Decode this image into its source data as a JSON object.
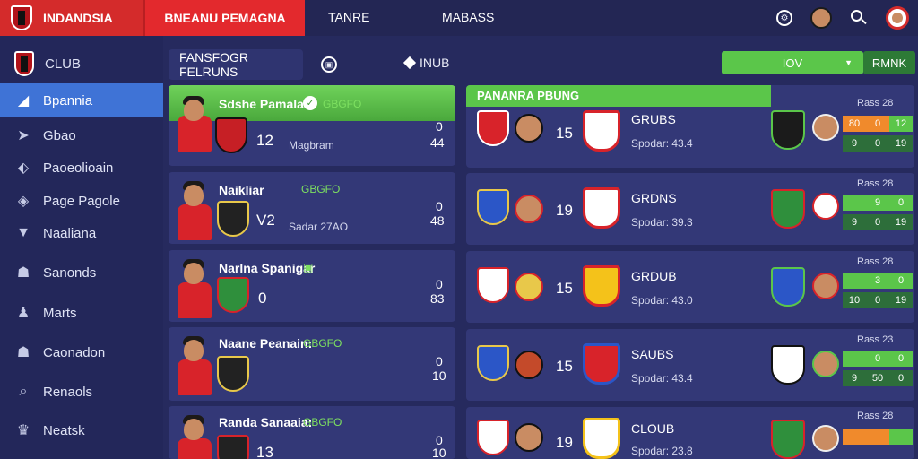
{
  "header": {
    "brand": "INDANDSIA",
    "active_tab": "BNEANU PEMAGNA",
    "tab2": "TANRE",
    "tab3": "MABASS"
  },
  "sidebar": {
    "club_label": "CLUB",
    "items": [
      {
        "label": "Bpannia"
      },
      {
        "label": "Gbao"
      },
      {
        "label": "Paoeolioain"
      },
      {
        "label": "Page Pagole"
      },
      {
        "label": "Naaliana"
      },
      {
        "label": "Sanonds"
      },
      {
        "label": "Marts"
      },
      {
        "label": "Caonadon"
      },
      {
        "label": "Renaols"
      },
      {
        "label": "Neatsk"
      }
    ]
  },
  "toolbar": {
    "filter_label": "FANSFOGR FELRUNS",
    "nav_label": "INUB",
    "select_value": "IOV",
    "action_label": "RMNK"
  },
  "players": [
    {
      "name": "Sdshe Pamalar",
      "tag": "GBGFO",
      "num": "12",
      "sub": "Magbram",
      "a": "0",
      "b": "44"
    },
    {
      "name": "Naikliar",
      "tag": "GBGFO",
      "num": "V2",
      "sub": "Sadar 27AO",
      "a": "0",
      "b": "48"
    },
    {
      "name": "Narlna Spanigar",
      "tag": "",
      "num": "0",
      "sub": "",
      "a": "0",
      "b": "83"
    },
    {
      "name": "Naane Peanain:",
      "tag": "GBGFO",
      "num": "",
      "sub": "",
      "a": "0",
      "b": "10"
    },
    {
      "name": "Randa Sanaaia:",
      "tag": "GBGFO",
      "num": "13",
      "sub": "",
      "a": "0",
      "b": "10"
    }
  ],
  "fixtures_header": "PANANRA PBUNG",
  "fixtures": [
    {
      "num": "15",
      "label": "GRUBS",
      "sub": "Spodar: 43.4",
      "grid_title": "Rass 28",
      "g": [
        "80",
        "0",
        "12",
        "9",
        "0",
        "19"
      ]
    },
    {
      "num": "19",
      "label": "GRDNS",
      "sub": "Spodar: 39.3",
      "grid_title": "Rass 28",
      "g": [
        "",
        "9",
        "0",
        "9",
        "0",
        "19"
      ]
    },
    {
      "num": "15",
      "label": "GRDUB",
      "sub": "Spodar: 43.0",
      "grid_title": "Rass 28",
      "g": [
        "",
        "3",
        "0",
        "10",
        "0",
        "19"
      ]
    },
    {
      "num": "15",
      "label": "SAUBS",
      "sub": "Spodar: 43.4",
      "grid_title": "Rass 23",
      "g": [
        "",
        "0",
        "0",
        "9",
        "50",
        "0"
      ]
    },
    {
      "num": "19",
      "label": "CLOUB",
      "sub": "Spodar: 23.8",
      "grid_title": "Rass 28",
      "g": [
        "",
        "",
        "",
        "",
        "",
        ""
      ]
    }
  ]
}
